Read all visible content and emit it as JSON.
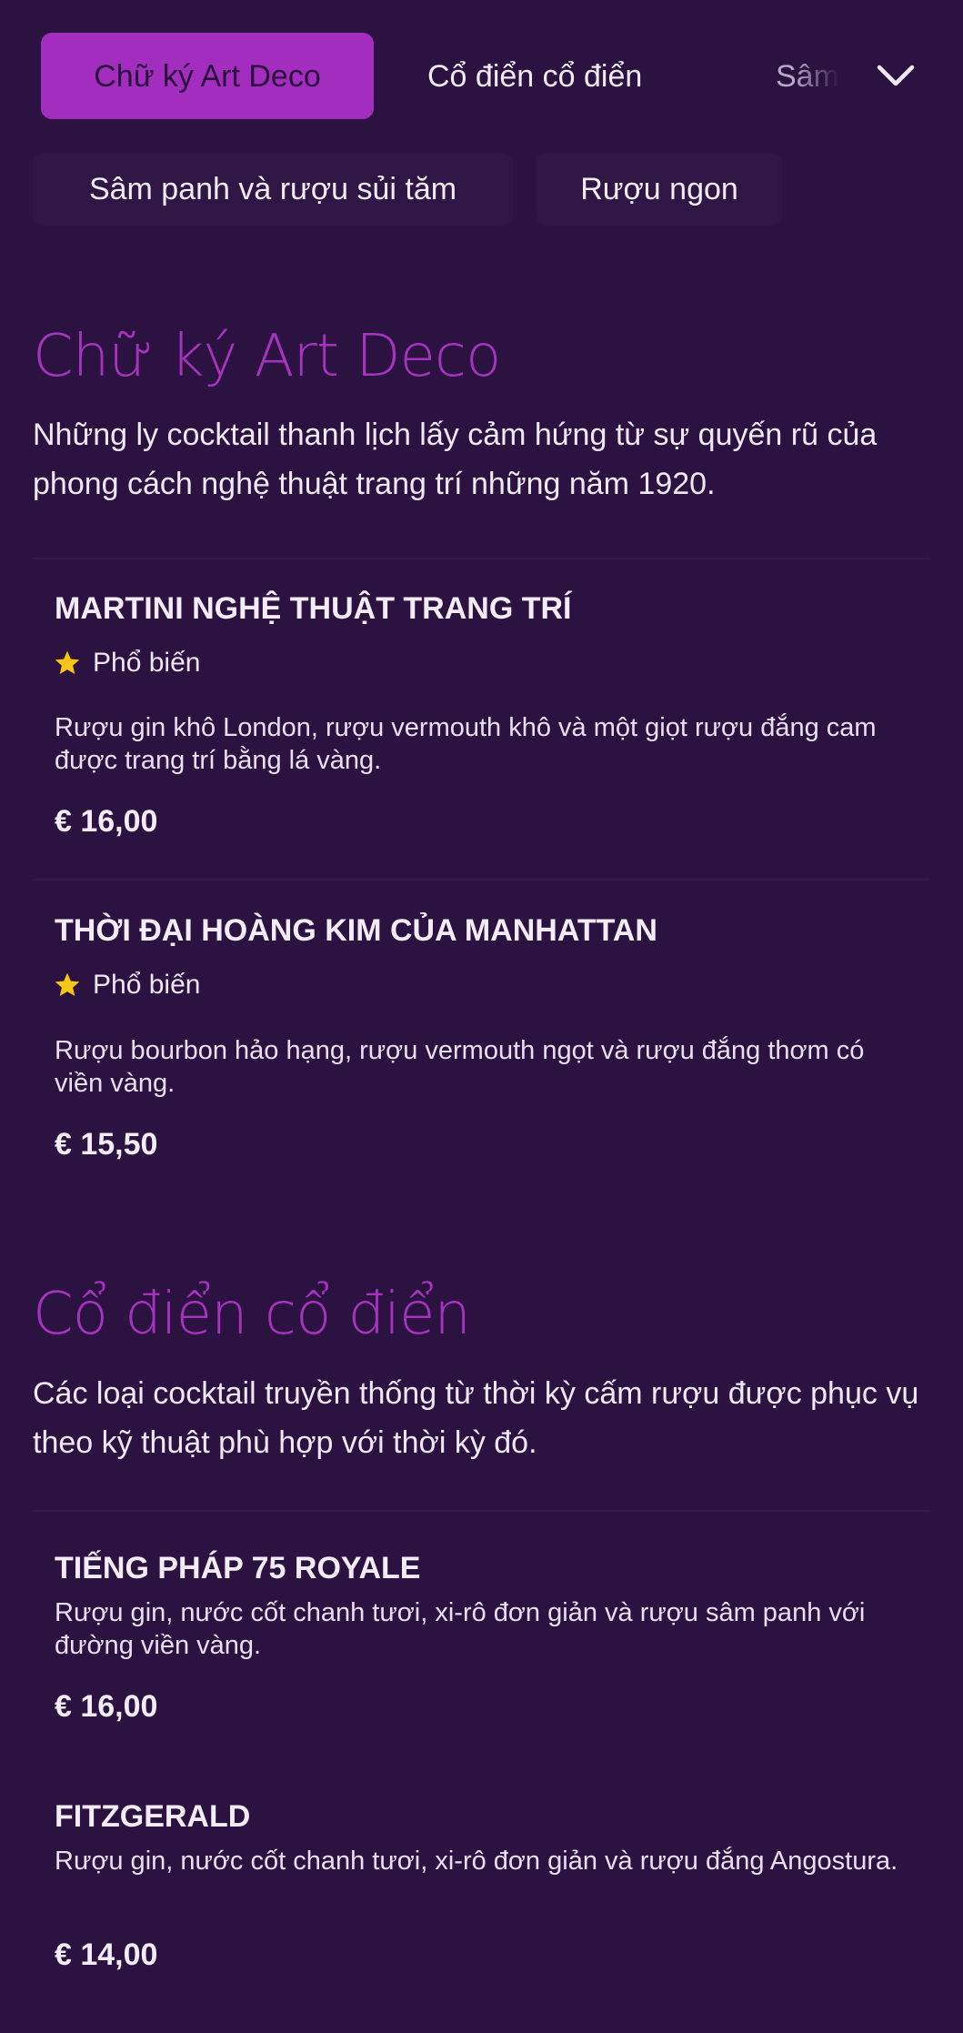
{
  "tabs": {
    "active": "Chữ ký Art Deco",
    "classic": "Cổ điển cổ điển",
    "partial": "Sâm",
    "sparkling": "Sâm panh và rượu sủi tăm",
    "wine": "Rượu ngon"
  },
  "colors": {
    "background": "#2c1240",
    "accent": "#a32dbe",
    "star": "#f5c518"
  },
  "icons": {
    "expand": "chevron-down-icon",
    "popular": "star-icon"
  },
  "sections": [
    {
      "title": "Chữ ký Art Deco",
      "description": "Những ly cocktail thanh lịch lấy cảm hứng từ sự quyến rũ của phong cách nghệ thuật trang trí những năm 1920.",
      "items": [
        {
          "name": "MARTINI NGHỆ THUẬT TRANG TRÍ",
          "badge": "Phổ biến",
          "description": "Rượu gin khô London, rượu vermouth khô và một giọt rượu đắng cam được trang trí bằng lá vàng.",
          "price": "€ 16,00"
        },
        {
          "name": "THỜI ĐẠI HOÀNG KIM CỦA MANHATTAN",
          "badge": "Phổ biến",
          "description": "Rượu bourbon hảo hạng, rượu vermouth ngọt và rượu đắng thơm có viền vàng.",
          "price": "€ 15,50"
        }
      ]
    },
    {
      "title": "Cổ điển cổ điển",
      "description": "Các loại cocktail truyền thống từ thời kỳ cấm rượu được phục vụ theo kỹ thuật phù hợp với thời kỳ đó.",
      "items": [
        {
          "name": "TIẾNG PHÁP 75 ROYALE",
          "description": "Rượu gin, nước cốt chanh tươi, xi-rô đơn giản và rượu sâm panh với đường viền vàng.",
          "price": "€ 16,00"
        },
        {
          "name": "FITZGERALD",
          "description": "Rượu gin, nước cốt chanh tươi, xi-rô đơn giản và rượu đắng Angostura.",
          "price": "€ 14,00"
        }
      ]
    }
  ]
}
